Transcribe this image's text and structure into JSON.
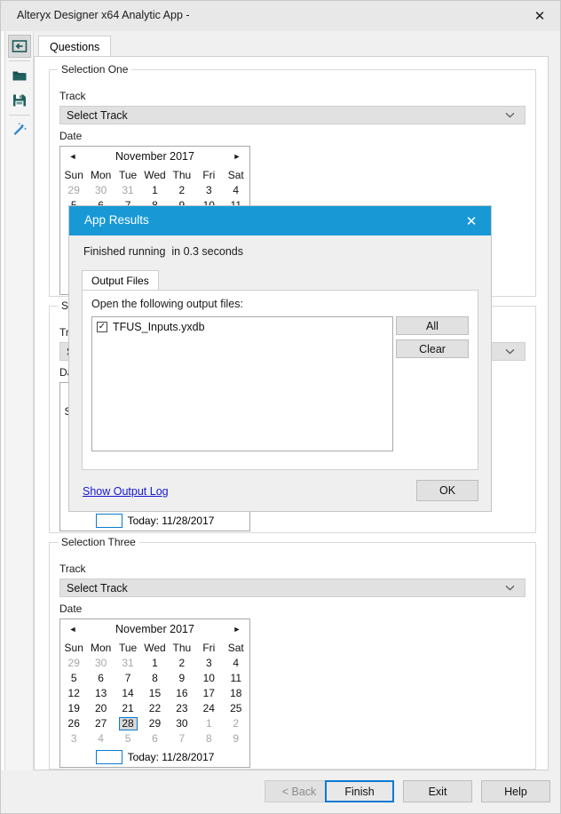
{
  "window": {
    "title": "Alteryx Designer x64 Analytic App -",
    "close_label": "✕"
  },
  "rail": {
    "icons": [
      {
        "name": "back-arrow-icon",
        "label": "back-arrow"
      },
      {
        "name": "folder-open-icon",
        "label": "open"
      },
      {
        "name": "save-disk-icon",
        "label": "save"
      },
      {
        "name": "magic-wand-icon",
        "label": "wizard"
      }
    ]
  },
  "tabs": {
    "questions": "Questions"
  },
  "calendar_common": {
    "month_title": "November 2017",
    "prev": "◄",
    "next": "►",
    "weekdays": [
      "Sun",
      "Mon",
      "Tue",
      "Wed",
      "Thu",
      "Fri",
      "Sat"
    ],
    "weeks": [
      [
        {
          "d": "29",
          "m": true
        },
        {
          "d": "30",
          "m": true
        },
        {
          "d": "31",
          "m": true
        },
        {
          "d": "1"
        },
        {
          "d": "2"
        },
        {
          "d": "3"
        },
        {
          "d": "4"
        }
      ],
      [
        {
          "d": "5"
        },
        {
          "d": "6"
        },
        {
          "d": "7"
        },
        {
          "d": "8"
        },
        {
          "d": "9"
        },
        {
          "d": "10"
        },
        {
          "d": "11"
        }
      ],
      [
        {
          "d": "12"
        },
        {
          "d": "13"
        },
        {
          "d": "14"
        },
        {
          "d": "15"
        },
        {
          "d": "16"
        },
        {
          "d": "17"
        },
        {
          "d": "18"
        }
      ],
      [
        {
          "d": "19"
        },
        {
          "d": "20"
        },
        {
          "d": "21"
        },
        {
          "d": "22"
        },
        {
          "d": "23"
        },
        {
          "d": "24"
        },
        {
          "d": "25"
        }
      ],
      [
        {
          "d": "26"
        },
        {
          "d": "27"
        },
        {
          "d": "28",
          "sel": true
        },
        {
          "d": "29"
        },
        {
          "d": "30"
        },
        {
          "d": "1",
          "m": true
        },
        {
          "d": "2",
          "m": true
        }
      ],
      [
        {
          "d": "3",
          "m": true
        },
        {
          "d": "4",
          "m": true
        },
        {
          "d": "5",
          "m": true
        },
        {
          "d": "6",
          "m": true
        },
        {
          "d": "7",
          "m": true
        },
        {
          "d": "8",
          "m": true
        },
        {
          "d": "9",
          "m": true
        }
      ]
    ],
    "today_label": "Today: 11/28/2017"
  },
  "selections": [
    {
      "legend": "Selection One",
      "track_label": "Track",
      "track_value": "Select Track",
      "date_label": "Date"
    },
    {
      "legend": "Selection Two",
      "track_label": "Track",
      "track_value": "Select Track",
      "date_label": "Date"
    },
    {
      "legend": "Selection Three",
      "track_label": "Track",
      "track_value": "Select Track",
      "date_label": "Date"
    }
  ],
  "buttonbar": {
    "back": "< Back",
    "finish": "Finish",
    "exit": "Exit",
    "help": "Help"
  },
  "app_results": {
    "title": "App Results",
    "close_label": "✕",
    "status": "Finished running  in 0.3 seconds",
    "tab": "Output Files",
    "prompt": "Open the following output files:",
    "files": [
      {
        "name": "TFUS_Inputs.yxdb",
        "checked": true,
        "check_glyph": "✓"
      }
    ],
    "all_button": "All",
    "clear_button": "Clear",
    "show_log_link": "Show Output Log",
    "ok_button": "OK"
  },
  "colors": {
    "dialog_header": "#1899d6",
    "accent_focus": "#0a7ad1",
    "link": "#1717d0",
    "icon_teal": "#1f5b5b"
  }
}
